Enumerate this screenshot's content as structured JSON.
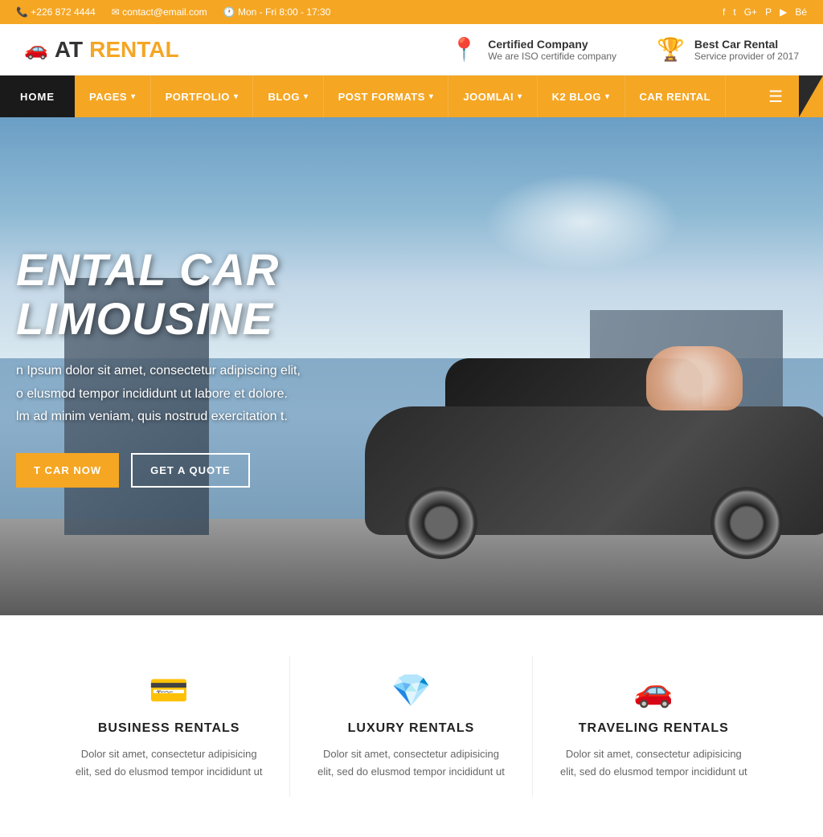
{
  "topbar": {
    "phone": "+226 872 4444",
    "email": "contact@email.com",
    "hours": "Mon - Fri 8:00 - 17:30",
    "phone_icon": "📞",
    "email_icon": "✉",
    "clock_icon": "🕐"
  },
  "header": {
    "logo_prefix": "AT",
    "logo_suffix": "RENTAL",
    "logo_icon": "🚗",
    "feature1_title": "Certified Company",
    "feature1_desc": "We are ISO certifide company",
    "feature1_icon": "📍",
    "feature2_title": "Best Car Rental",
    "feature2_desc": "Service provider of 2017",
    "feature2_icon": "🏆"
  },
  "nav": {
    "items": [
      {
        "label": "HOME",
        "has_arrow": false
      },
      {
        "label": "PAGES",
        "has_arrow": true
      },
      {
        "label": "PORTFOLIO",
        "has_arrow": true
      },
      {
        "label": "BLOG",
        "has_arrow": true
      },
      {
        "label": "POST FORMATS",
        "has_arrow": true
      },
      {
        "label": "JOOMLAI",
        "has_arrow": true
      },
      {
        "label": "K2 BLOG",
        "has_arrow": true
      },
      {
        "label": "CAR RENTAL",
        "has_arrow": false
      }
    ]
  },
  "hero": {
    "title": "ENTAL CAR LIMOUSINE",
    "subtitle_line1": "n Ipsum dolor sit amet, consectetur adipiscing elit,",
    "subtitle_line2": "o elusmod tempor incididunt ut labore et dolore.",
    "subtitle_line3": "lm ad minim veniam, quis nostrud exercitation t.",
    "btn_rent": "T CAR NOW",
    "btn_quote": "GET A QUOTE"
  },
  "features": [
    {
      "icon": "💳",
      "title": "BUSINESS RENTALS",
      "desc": "Dolor sit amet, consectetur adipisicing elit, sed do elusmod tempor incididunt ut"
    },
    {
      "icon": "💎",
      "title": "LUXURY RENTALS",
      "desc": "Dolor sit amet, consectetur adipisicing elit, sed do elusmod tempor incididunt ut"
    },
    {
      "icon": "🚗",
      "title": "TRAVELING RENTALS",
      "desc": "Dolor sit amet, consectetur adipisicing elit, sed do elusmod tempor incididunt ut"
    }
  ],
  "colors": {
    "accent": "#f5a623",
    "dark": "#1a1a1a",
    "white": "#ffffff"
  }
}
